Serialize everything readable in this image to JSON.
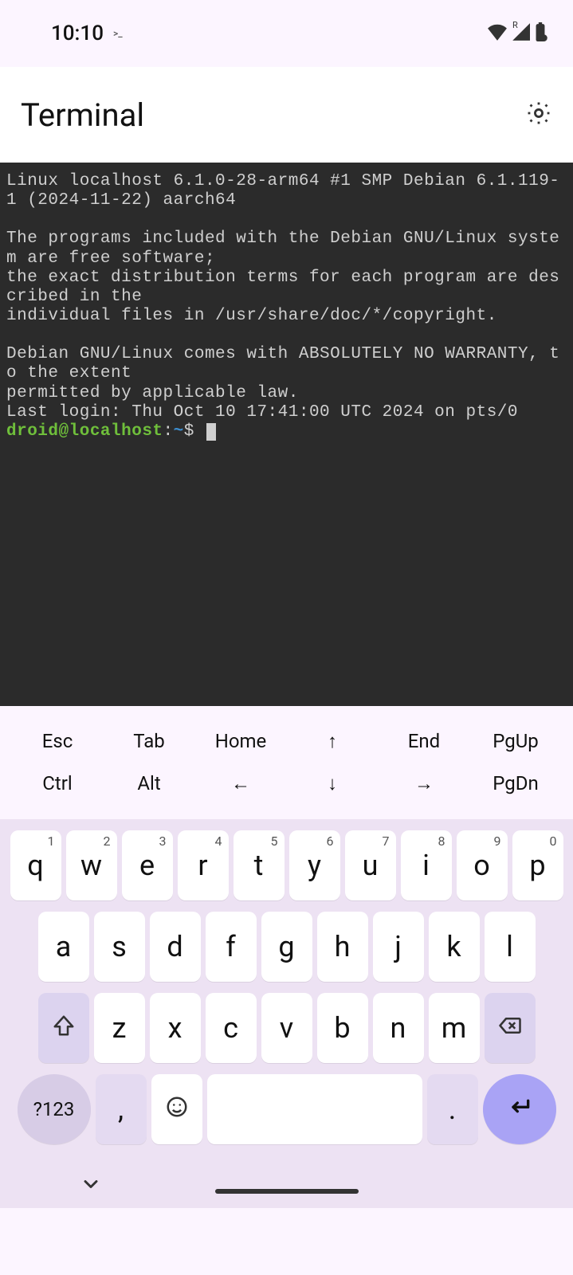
{
  "status": {
    "time": "10:10",
    "prompt_icon": ">_",
    "network_label": "R"
  },
  "header": {
    "title": "Terminal"
  },
  "terminal": {
    "motd_lines": [
      "Linux localhost 6.1.0-28-arm64 #1 SMP Debian 6.1.119-1 (2024-11-22) aarch64",
      "",
      "The programs included with the Debian GNU/Linux system are free software;",
      "the exact distribution terms for each program are described in the",
      "individual files in /usr/share/doc/*/copyright.",
      "",
      "Debian GNU/Linux comes with ABSOLUTELY NO WARRANTY, to the extent",
      "permitted by applicable law.",
      "Last login: Thu Oct 10 17:41:00 UTC 2024 on pts/0"
    ],
    "prompt": {
      "user_host": "droid@localhost",
      "separator": ":",
      "path": "~",
      "symbol": "$"
    }
  },
  "fn_keys": {
    "row1": [
      "Esc",
      "Tab",
      "Home",
      "↑",
      "End",
      "PgUp"
    ],
    "row2": [
      "Ctrl",
      "Alt",
      "←",
      "↓",
      "→",
      "PgDn"
    ]
  },
  "keyboard": {
    "row1": [
      {
        "k": "q",
        "h": "1"
      },
      {
        "k": "w",
        "h": "2"
      },
      {
        "k": "e",
        "h": "3"
      },
      {
        "k": "r",
        "h": "4"
      },
      {
        "k": "t",
        "h": "5"
      },
      {
        "k": "y",
        "h": "6"
      },
      {
        "k": "u",
        "h": "7"
      },
      {
        "k": "i",
        "h": "8"
      },
      {
        "k": "o",
        "h": "9"
      },
      {
        "k": "p",
        "h": "0"
      }
    ],
    "row2": [
      "a",
      "s",
      "d",
      "f",
      "g",
      "h",
      "j",
      "k",
      "l"
    ],
    "row3": [
      "z",
      "x",
      "c",
      "v",
      "b",
      "n",
      "m"
    ],
    "sym": "?123",
    "comma": ",",
    "period": "."
  }
}
